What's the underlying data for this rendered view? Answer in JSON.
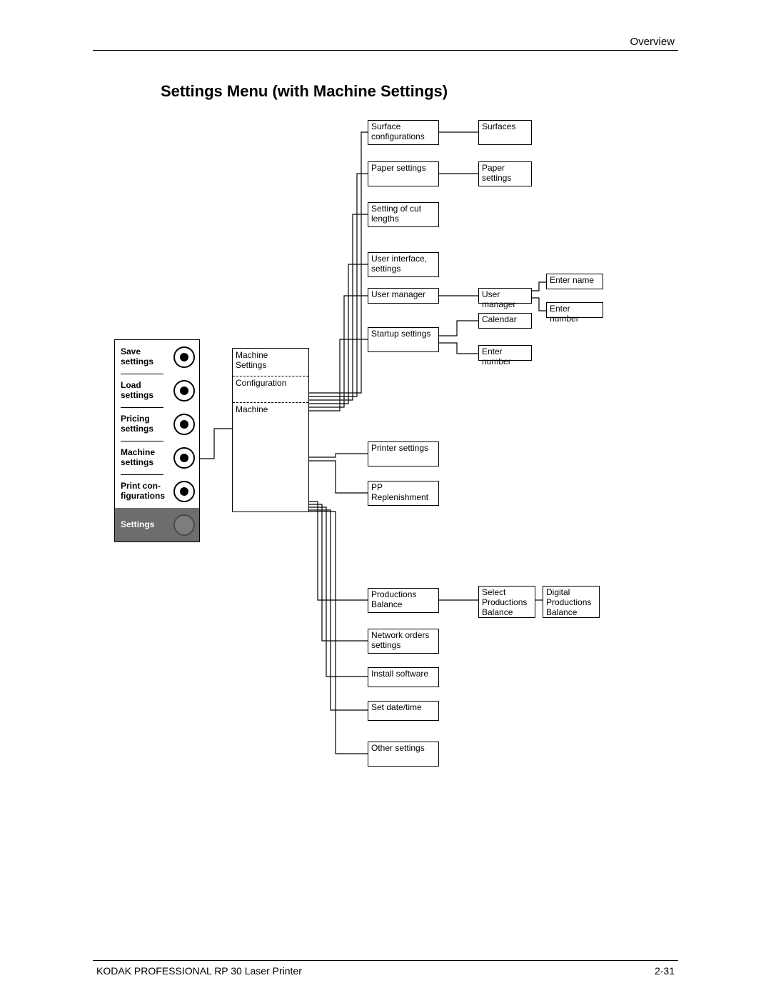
{
  "header": {
    "section": "Overview"
  },
  "title": "Settings Menu (with Machine Settings)",
  "footer": {
    "left": "KODAK PROFESSIONAL RP 30 Laser Printer",
    "right": "2-31"
  },
  "sidebar": {
    "items": [
      {
        "label1": "Save",
        "label2": "settings"
      },
      {
        "label1": "Load",
        "label2": "settings"
      },
      {
        "label1": "Pricing",
        "label2": "settings"
      },
      {
        "label1": "Machine",
        "label2": "settings"
      },
      {
        "label1": "Print con-",
        "label2": "figurations"
      }
    ],
    "current": "Settings"
  },
  "msbox": {
    "a1": "Machine",
    "a2": "Settings",
    "b1": "Configuration",
    "c1": "Machine"
  },
  "nodes": {
    "surface_conf": "Surface\nconfigurations",
    "paper_settings_1": "Paper\nsettings",
    "cut_lengths": "Setting of cut\nlengths",
    "ui_settings": "User interface,\nsettings",
    "user_mgr_1": "User manager",
    "startup": "Startup\nsettings",
    "printer_settings": "Printer\nsettings",
    "pp_replen": "PP\nReplenishment",
    "prod_balance": "Productions\nBalance",
    "network_orders": "Network orders\nsettings",
    "install_sw": "Install software",
    "set_dt": "Set date/time",
    "other": "Other\nsettings",
    "surfaces": "Surfaces",
    "paper_settings_2": "Paper\nsettings",
    "user_mgr_2": "User manager",
    "calendar": "Calendar",
    "enter_number_ss": "Enter number",
    "enter_name": "Enter name",
    "enter_number_um": "Enter number",
    "select_pb": "Select\nProductions\nBalance",
    "digital_pb": "Digital\nProductions\nBalance"
  }
}
